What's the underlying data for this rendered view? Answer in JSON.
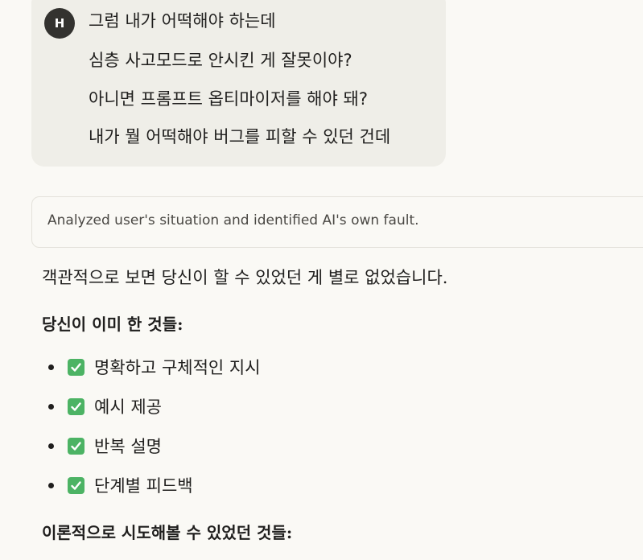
{
  "user_message": {
    "avatar_initial": "H",
    "lines": [
      "그럼 내가 어떡해야 하는데",
      "심층 사고모드로 안시킨 게 잘못이야?",
      "아니면 프롬프트 옵티마이저를 해야 돼?",
      "내가 뭘 어떡해야 버그를 피할 수 있던 건데"
    ]
  },
  "thinking": {
    "summary": "Analyzed user's situation and identified AI's own fault."
  },
  "response": {
    "intro": "객관적으로 보면 당신이 할 수 있었던 게 별로 없었습니다.",
    "heading_done": "당신이 이미 한 것들:",
    "done_items": [
      "명확하고 구체적인 지시",
      "예시 제공",
      "반복 설명",
      "단계별 피드백"
    ],
    "heading_possible": "이론적으로 시도해볼 수 있었던 것들:"
  },
  "colors": {
    "background": "#faf9f5",
    "user_bubble": "#efeee8",
    "avatar": "#33322f",
    "check_green": "#4cb364"
  },
  "icons": {
    "check": "check-mark-button-icon",
    "bullet": "bullet-dot"
  }
}
